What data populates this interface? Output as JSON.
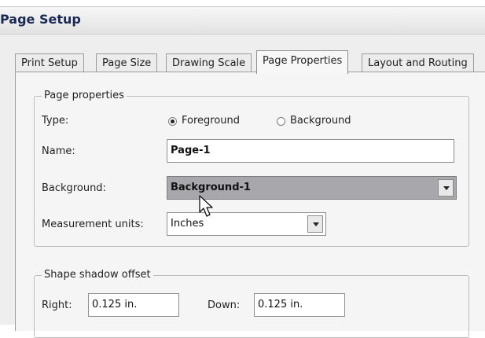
{
  "window": {
    "title": "Page Setup"
  },
  "tabs": [
    {
      "label": "Print Setup",
      "active": false
    },
    {
      "label": "Page Size",
      "active": false
    },
    {
      "label": "Drawing Scale",
      "active": false
    },
    {
      "label": "Page Properties",
      "active": true
    },
    {
      "label": "Layout and Routing",
      "active": false
    }
  ],
  "page_properties": {
    "legend": "Page properties",
    "type_label": "Type:",
    "type_options": [
      "Foreground",
      "Background"
    ],
    "type_selected": "Foreground",
    "name_label": "Name:",
    "name_value": "Page-1",
    "background_label": "Background:",
    "background_value": "Background-1",
    "units_label": "Measurement units:",
    "units_value": "Inches"
  },
  "shadow_offset": {
    "legend": "Shape shadow offset",
    "right_label": "Right:",
    "right_value": "0.125 in.",
    "down_label": "Down:",
    "down_value": "0.125 in."
  },
  "icons": [
    "dropdown-arrow-icon",
    "mouse-pointer-icon"
  ]
}
